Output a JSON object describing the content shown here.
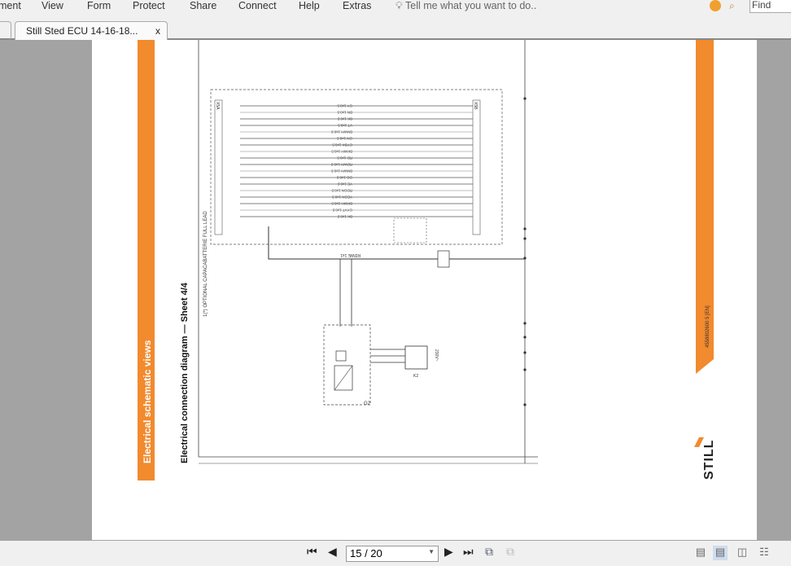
{
  "menu": {
    "items": [
      "ment",
      "View",
      "Form",
      "Protect",
      "Share",
      "Connect",
      "Help",
      "Extras"
    ],
    "tell_me": "Tell me what you want to do..",
    "find_placeholder": "Find"
  },
  "tab": {
    "title": "Still Sted ECU 14-16-18...",
    "close": "x"
  },
  "document": {
    "section_title": "Electrical schematic views",
    "sheet_title": "Electrical connection diagram — Sheet 4/4",
    "note": "1(*) OPTIONAL CAPACABATTERIE FULL LEAD",
    "doc_number": "4558802600 5 [EN]",
    "logo": "STILL",
    "connector_left": "X5A",
    "connector_right": "X5B",
    "component_g2": "G2",
    "component_k2": "K2",
    "component_k2_label": "230V~",
    "wire_labels": [
      "GY 1x0.5",
      "BN 1x0.5",
      "BK 1x0.5",
      "VT 1x0.5",
      "BNWH 1x0.5",
      "GN 1x0.5",
      "GYBK 1x0.5",
      "BKWH 1x0.5",
      "RD 1x0.5",
      "RDWH 1x0.5",
      "BNWH 1x0.5",
      "OG 1x0.5",
      "YE 1x0.5",
      "RDGN 1x0.5",
      "YEGN 1x0.5",
      "BKWH 1x0.5",
      "GYVT 1x0.5",
      "BK 1x0.5"
    ],
    "bus_label": "RDWE 1x1",
    "colors": {
      "orange": "#f28a2e"
    }
  },
  "nav": {
    "page_value": "15 / 20"
  }
}
